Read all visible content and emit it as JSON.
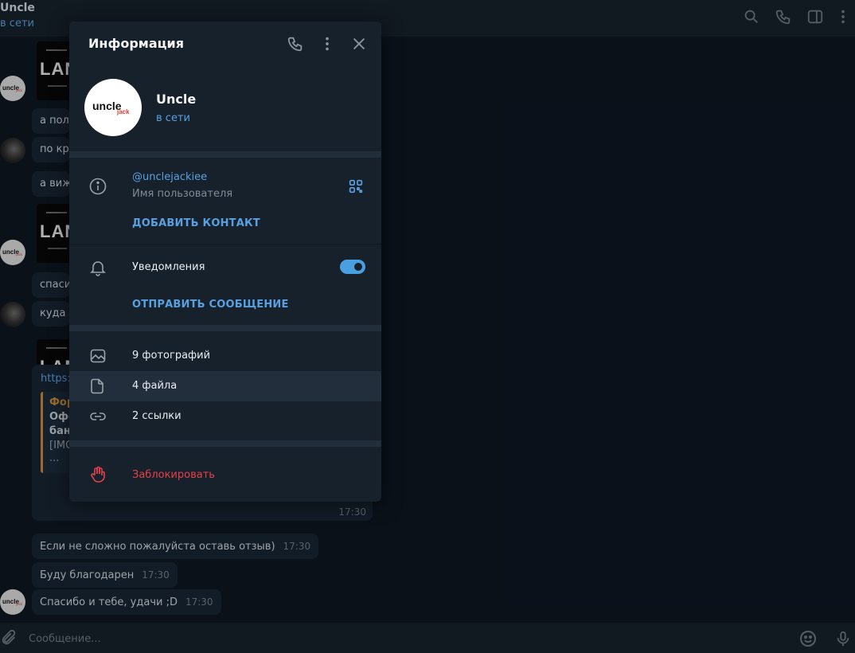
{
  "chat": {
    "title": "Uncle",
    "status": "в сети"
  },
  "messages": {
    "bubbles": [
      {
        "text": "а пол",
        "time": ""
      },
      {
        "text": "по кр",
        "time": ""
      },
      {
        "text": "а виж",
        "time": ""
      },
      {
        "text": "спаси",
        "time": ""
      },
      {
        "text": "куда с",
        "time": ""
      },
      {
        "text": "Если не сложно пожалуйста оставь отзыв)",
        "time": "17:30"
      },
      {
        "text": "Буду благодарен",
        "time": "17:30"
      },
      {
        "text": "Спасибо и тебе, удачи ;D",
        "time": "17:30"
      }
    ],
    "image_text": "LAN",
    "link": {
      "url": "https:",
      "quote_line1": "Фор",
      "quote_line2": "Офс",
      "quote_line3": "бан",
      "quote_line4": "[IMG",
      "quote_line5": "...",
      "time": "17:30"
    },
    "avatar_text_main": "uncle",
    "avatar_text_sub": "jack"
  },
  "composer": {
    "placeholder": "Сообщение..."
  },
  "panel": {
    "title": "Информация",
    "profile": {
      "name": "Uncle",
      "status": "в сети",
      "logo_main": "uncle",
      "logo_sub": "jack"
    },
    "username": "@unclejackiee",
    "username_label": "Имя пользователя",
    "add_contact": "ДОБАВИТЬ КОНТАКТ",
    "notifications_label": "Уведомления",
    "notifications_on": true,
    "send_message": "ОТПРАВИТЬ СООБЩЕНИЕ",
    "media": [
      {
        "label": "9 фотографий",
        "icon": "photo-icon"
      },
      {
        "label": "4 файла",
        "icon": "file-icon"
      },
      {
        "label": "2 ссылки",
        "icon": "link-icon"
      }
    ],
    "block": "Заблокировать"
  },
  "colors": {
    "accent": "#5aa0e0",
    "danger": "#e5404a",
    "panel_bg": "#17212b",
    "chat_bg": "#0e1621"
  }
}
